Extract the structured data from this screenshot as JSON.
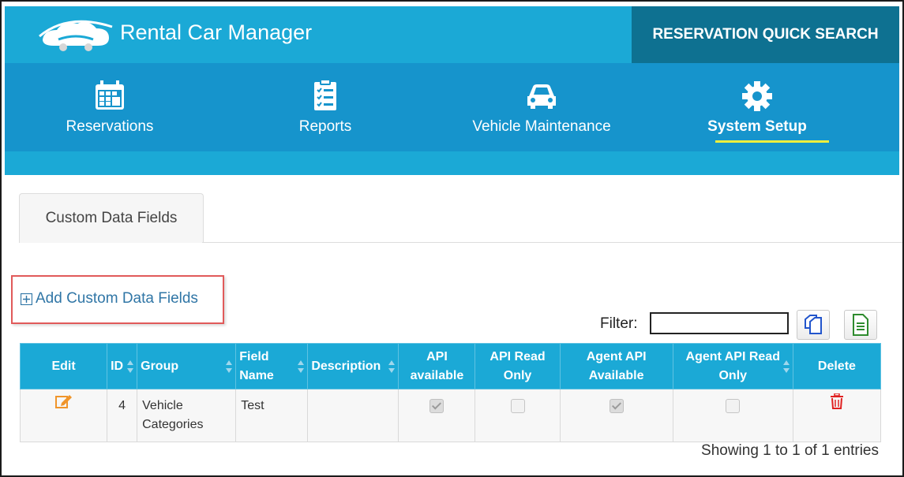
{
  "header": {
    "app_title": "Rental Car Manager",
    "quick_search_label": "RESERVATION QUICK SEARCH",
    "logo_icon": "cloud-car-logo-icon"
  },
  "nav": {
    "items": [
      {
        "label": "Reservations",
        "icon": "calendar-icon"
      },
      {
        "label": "Reports",
        "icon": "clipboard-icon"
      },
      {
        "label": "Vehicle Maintenance",
        "icon": "car-icon"
      },
      {
        "label": "System Setup",
        "icon": "gear-icon",
        "active": true
      }
    ],
    "active_underline_color": "#f0ef3d"
  },
  "tabs": [
    {
      "label": "Custom Data Fields",
      "active": true
    }
  ],
  "actions": {
    "add_label": "Add Custom Data Fields"
  },
  "filter": {
    "label": "Filter:",
    "value": ""
  },
  "toolbar": {
    "copy_icon": "copy-icon",
    "export_icon": "export-document-icon"
  },
  "table": {
    "columns": [
      "Edit",
      "ID",
      "Group",
      "Field Name",
      "Description",
      "API available",
      "API Read Only",
      "Agent API Available",
      "Agent API Read Only",
      "Delete"
    ],
    "rows": [
      {
        "id": "4",
        "group": "Vehicle Categories",
        "field_name": "Test",
        "description": "",
        "api_available": true,
        "api_read_only": false,
        "agent_api_available": true,
        "agent_api_read_only": false
      }
    ]
  },
  "footer": {
    "showing": "Showing 1 to 1 of 1 entries"
  },
  "colors": {
    "header_bg": "#1ba9d6",
    "nav_bg": "#1694cc",
    "quick_search_bg": "#0e7191",
    "link": "#3076a6",
    "highlight_border": "#e15a5a",
    "edit_icon": "#f0952b",
    "delete_icon": "#e02020"
  }
}
